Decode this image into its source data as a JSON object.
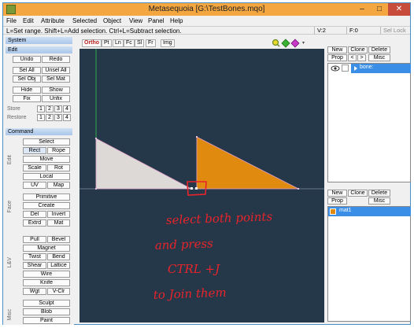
{
  "window": {
    "title": "Metasequoia [G:\\TestBones.mqo]"
  },
  "titlebar_buttons": {
    "minimize": "–",
    "maximize": "□",
    "close": "✕"
  },
  "menu": [
    "File",
    "Edit",
    "Attribute",
    "Selected",
    "Object",
    "View",
    "Panel",
    "Help"
  ],
  "status": {
    "message": "L=Set range.  Shift+L=Add selection.  Ctrl+L=Subtract selection.",
    "v": "V:2",
    "f": "F:0",
    "sel_lock": "Sel Lock"
  },
  "left": {
    "system": "System",
    "edit": "Edit",
    "edit_buttons": [
      [
        "Undo",
        "Redo"
      ],
      [
        "Sel All",
        "Unsel All"
      ],
      [
        "Sel Obj",
        "Sel Mat"
      ],
      [
        "Hide",
        "Show"
      ],
      [
        "Fix",
        "Unfix"
      ]
    ],
    "store": "Store",
    "restore": "Restore",
    "nums": [
      "1",
      "2",
      "3",
      "4"
    ],
    "command": "Command",
    "select": "Select",
    "edit_group": "Edit",
    "edit_cmds": [
      [
        "Rect",
        "Rope"
      ],
      [
        "Move"
      ],
      [
        "Scale",
        "Rot"
      ],
      [
        "Local"
      ],
      [
        "UV",
        "Map"
      ]
    ],
    "face_group": "Face",
    "face_cmds": [
      [
        "Primitive"
      ],
      [
        "Create"
      ],
      [
        "Del",
        "Invert"
      ],
      [
        "Extrd",
        "Mat"
      ]
    ],
    "lv_group": "L&V",
    "lv_cmds": [
      [
        "Pull",
        "Bevel"
      ],
      [
        "Magnet"
      ],
      [
        "Twist",
        "Bend"
      ],
      [
        "Shear",
        "Lattice"
      ],
      [
        "Wire"
      ],
      [
        "Knife"
      ],
      [
        "Wgt",
        "V-Clr"
      ]
    ],
    "misc_group": "Misc",
    "misc_cmds": [
      [
        "Sculpt"
      ],
      [
        "Blob"
      ],
      [
        "Paint"
      ]
    ]
  },
  "viewport": {
    "tabs": [
      "Ortho",
      "Pt",
      "Ln",
      "Fc",
      "Sl",
      "Fr",
      "Img"
    ],
    "annotation": [
      "select both points",
      "and press",
      "CTRL +J",
      "to Join them"
    ]
  },
  "right": {
    "obj_buttons_row1": [
      "New",
      "Clone",
      "Delete"
    ],
    "obj_buttons_row2": [
      "Prop",
      "<",
      ">",
      "Misc"
    ],
    "object_name": "bone:",
    "mat_buttons_row1": [
      "New",
      "Clone",
      "Delete"
    ],
    "mat_buttons_row2": [
      "Prop",
      "Misc"
    ],
    "material_name": "mat1"
  },
  "colors": {
    "titlebar": "#f4a640",
    "viewport_bg": "#24384a",
    "triangle_left": "#ddd9d6",
    "triangle_right": "#e08a10",
    "annotation": "#e8242a",
    "selection": "#3a8ee6"
  }
}
